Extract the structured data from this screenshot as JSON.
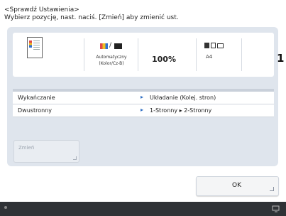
{
  "header": {
    "title": "<Sprawdź Ustawienia>",
    "instruction": "Wybierz pozycję, nast. naciś. [Zmień] aby zmienić ust."
  },
  "summary": {
    "color_mode_line1": "Automatyczny",
    "color_mode_line2": "(Kolor/Cz-B)",
    "zoom": "100%",
    "paper_size": "A4",
    "copies": "1"
  },
  "settings": {
    "rows": [
      {
        "label": "Wykańczanie",
        "value": "Układanie (Kolej. stron)"
      },
      {
        "label": "Dwustronny",
        "value": "1-Stronny ▸ 2-Stronny"
      }
    ]
  },
  "buttons": {
    "change_label": "Zmień",
    "ok_label": "OK"
  },
  "colors": {
    "panel_bg": "#dfe5ed",
    "accent_arrow": "#2f6fc4",
    "status_bar": "#2f3236"
  },
  "icons": {
    "document": "document-preview-icon",
    "color_mode": "color-bw-icon",
    "paper": "paper-drawer-icon",
    "status_left": "status-indicator-icon",
    "status_right": "monitor-icon"
  }
}
